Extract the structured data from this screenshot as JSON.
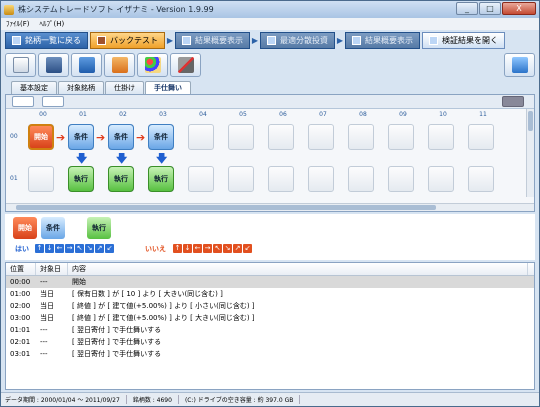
{
  "window": {
    "title": "株システムトレードソフト イザナミ - Version 1.9.99",
    "controls": [
      "_",
      "□",
      "X"
    ]
  },
  "menu": [
    "ﾌｧｲﾙ(F)",
    "ﾍﾙﾌﾟ(H)"
  ],
  "steps": [
    {
      "label": "銘柄一覧に戻る",
      "state": "normal"
    },
    {
      "label": "バックテスト",
      "state": "active"
    },
    {
      "label": "結果概要表示",
      "state": "dim"
    },
    {
      "label": "最適分散投資",
      "state": "dim"
    },
    {
      "label": "結果概要表示",
      "state": "dim"
    },
    {
      "label": "検証結果を開く",
      "state": "last"
    }
  ],
  "toolbar_icons": [
    "new-file-icon",
    "open-folder-icon",
    "save-icon",
    "export-icon",
    "palette-icon",
    "tools-icon",
    "home-icon"
  ],
  "tabs": [
    "基本設定",
    "対象銘柄",
    "仕掛け",
    "手仕舞い"
  ],
  "active_tab": 3,
  "grid": {
    "columns": [
      "00",
      "01",
      "02",
      "03",
      "04",
      "05",
      "06",
      "07",
      "08",
      "09",
      "10",
      "11"
    ],
    "rows": [
      "00",
      "01"
    ],
    "start_label": "開始",
    "cond_label": "条件",
    "act_label": "執行"
  },
  "palette": {
    "start": "開始",
    "cond": "条件",
    "act": "執行",
    "yes": "はい",
    "no": "いいえ",
    "arrows": [
      "↑",
      "↓",
      "←",
      "→",
      "↖",
      "↘",
      "↗",
      "↙"
    ]
  },
  "list": {
    "headers": [
      "位置",
      "対象日",
      "内容"
    ],
    "rows": [
      {
        "pos": "00:00",
        "date": "---",
        "content": "開始",
        "selected": true
      },
      {
        "pos": "01:00",
        "date": "当日",
        "content": "[ 保有日数 ] が [ 10 ] より [ 大きい(同じ含む) ]",
        "selected": false
      },
      {
        "pos": "02:00",
        "date": "当日",
        "content": "[ 終値 ] が [ 建て値(+5.00%) ] より [ 小さい(同じ含む) ]",
        "selected": false
      },
      {
        "pos": "03:00",
        "date": "当日",
        "content": "[ 終値 ] が [ 建て値(+5.00%) ] より [ 大きい(同じ含む) ]",
        "selected": false
      },
      {
        "pos": "01:01",
        "date": "---",
        "content": "[ 翌日寄付 ] で手仕舞いする",
        "selected": false
      },
      {
        "pos": "02:01",
        "date": "---",
        "content": "[ 翌日寄付 ] で手仕舞いする",
        "selected": false
      },
      {
        "pos": "03:01",
        "date": "---",
        "content": "[ 翌日寄付 ] で手仕舞いする",
        "selected": false
      }
    ]
  },
  "status": {
    "period": "データ期間 : 2000/01/04 ～ 2011/09/27",
    "count": "銘柄数 : 4690",
    "disk": "(C:) ドライブの空き容量 : 約 397.0 GB"
  }
}
